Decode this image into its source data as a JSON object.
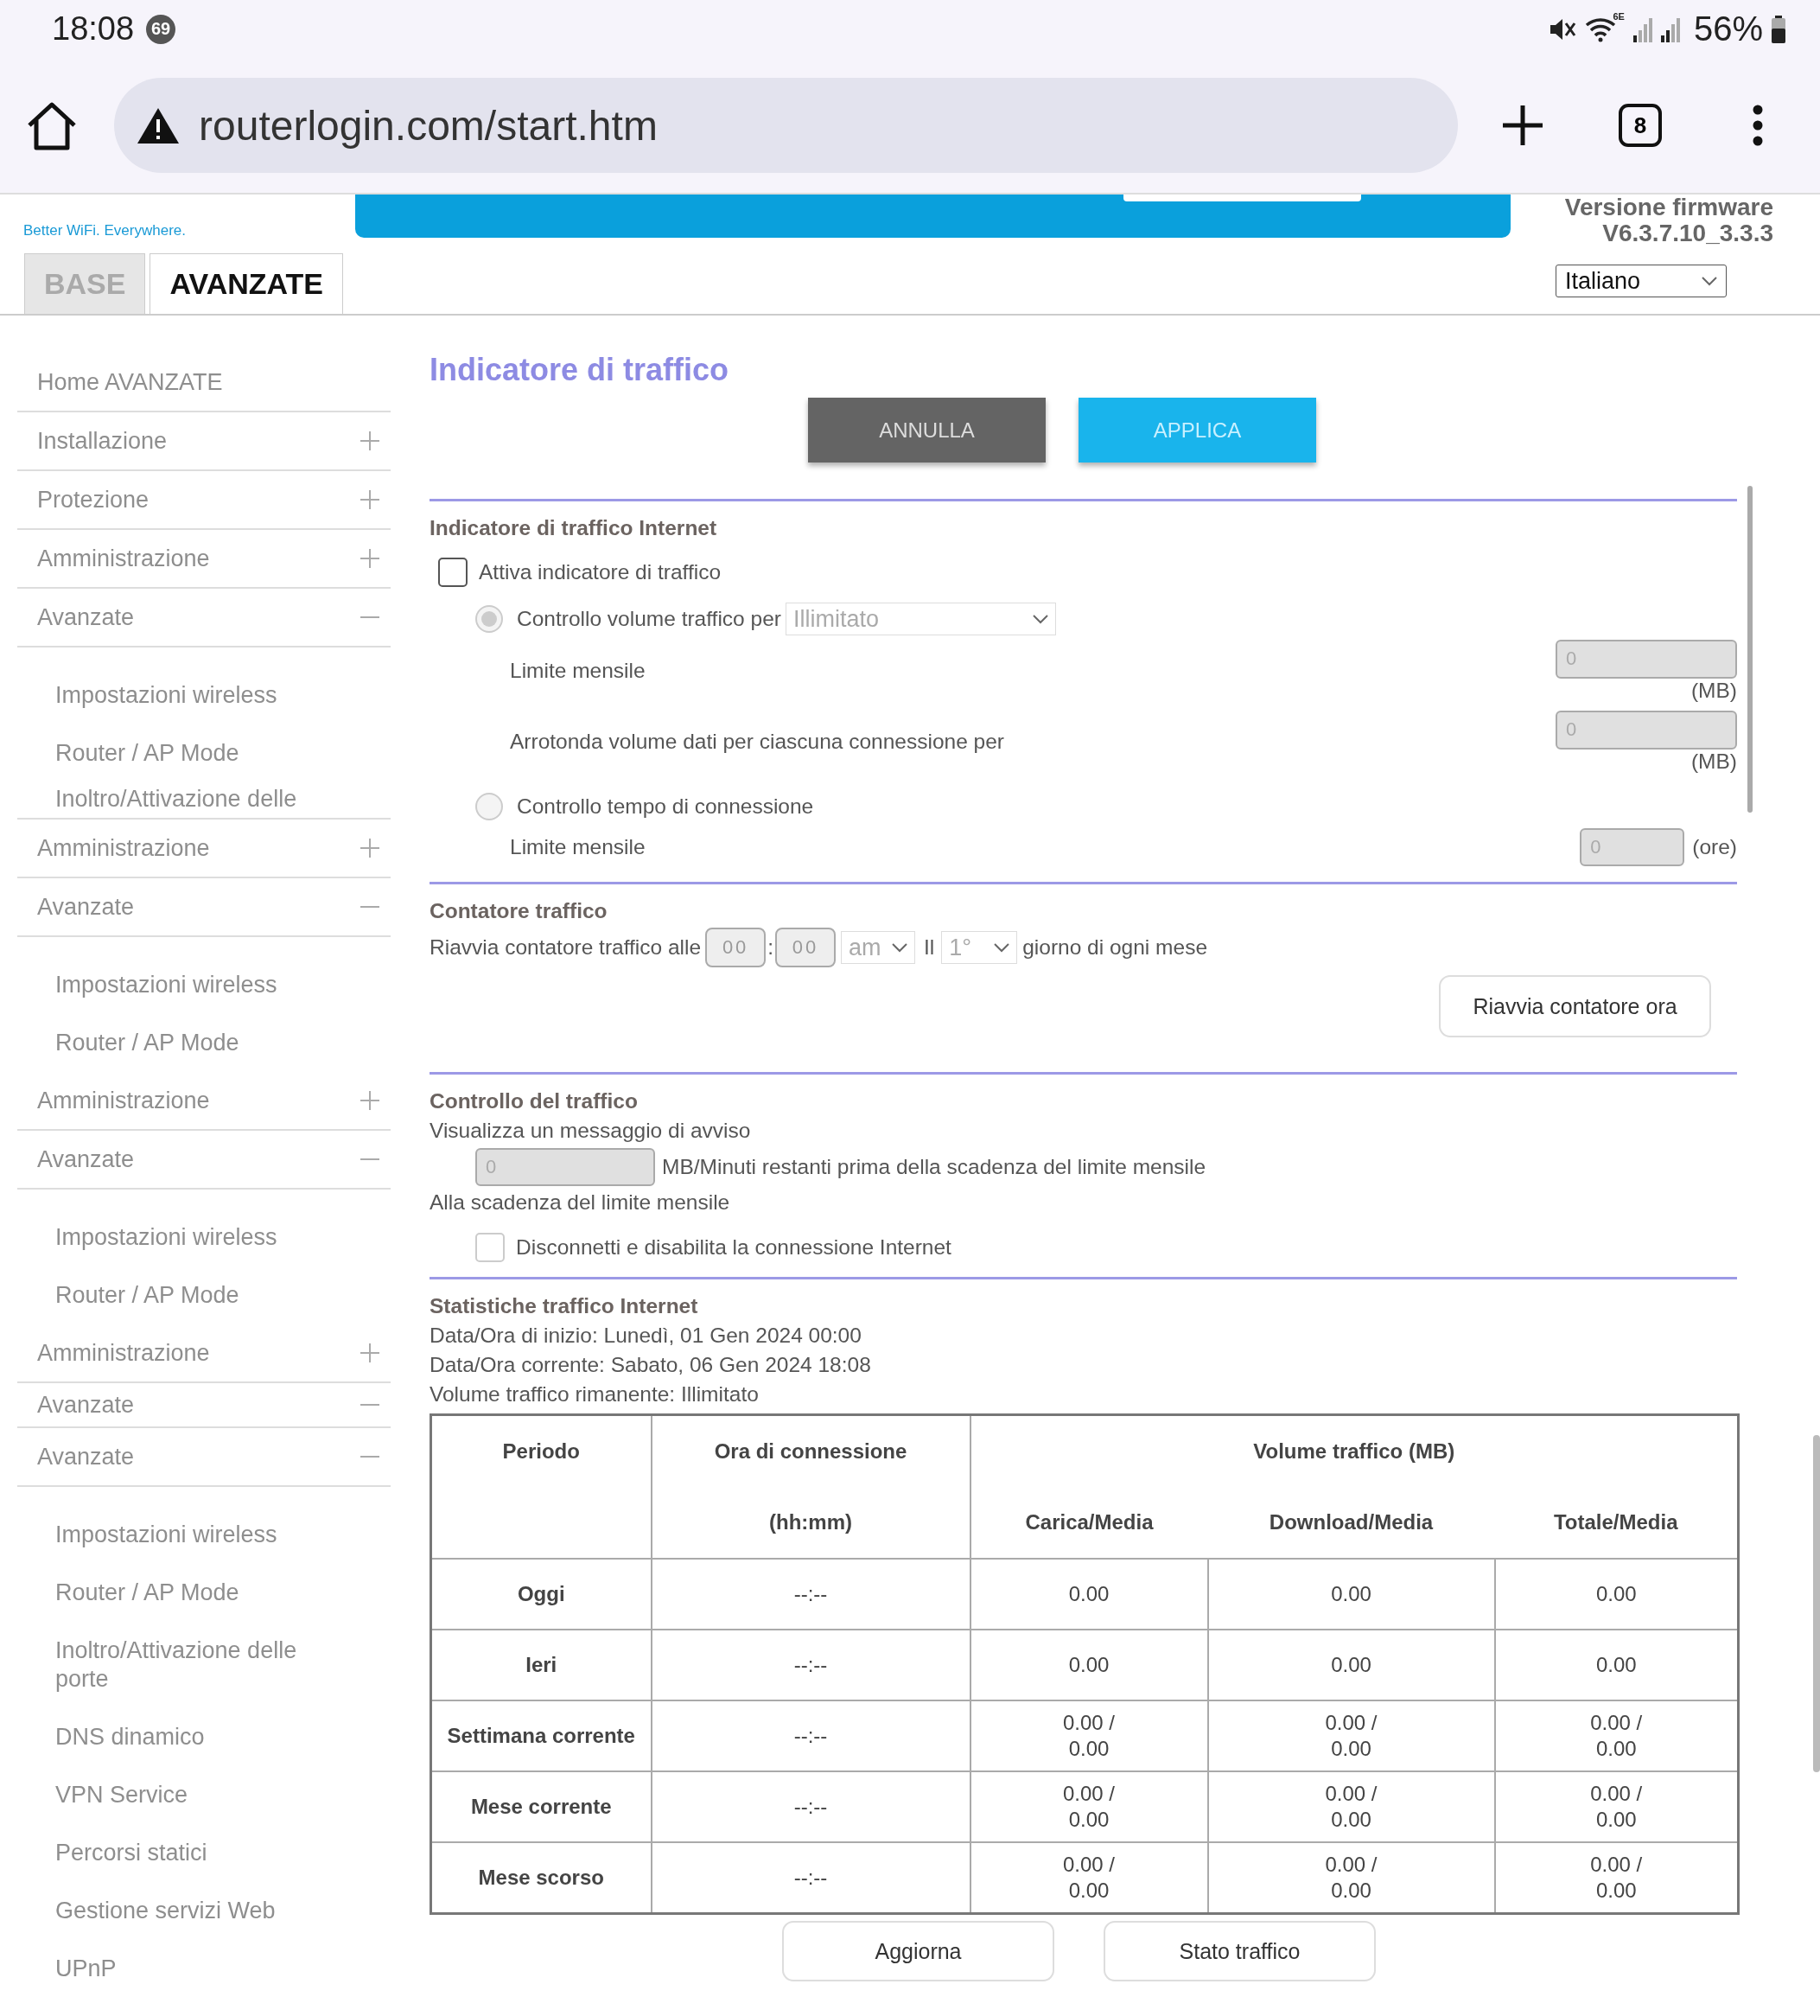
{
  "status_bar": {
    "time": "18:08",
    "notification_count": "69",
    "wifi_label": "6E",
    "battery": "56%"
  },
  "browser": {
    "url": "routerlogin.com/start.htm",
    "tab_count": "8"
  },
  "header": {
    "tagline": "Better WiFi. Everywhere.",
    "firmware_label": "Versione firmware",
    "firmware_version": "V6.3.7.10_3.3.3",
    "tabs": [
      {
        "label": "BASE",
        "selected": false
      },
      {
        "label": "AVANZATE",
        "selected": true
      }
    ],
    "language": "Italiano"
  },
  "sidebar": {
    "items": [
      {
        "label": "Home AVANZATE",
        "kind": "home"
      },
      {
        "label": "Installazione",
        "kind": "section",
        "expanded": false
      },
      {
        "label": "Protezione",
        "kind": "section",
        "expanded": false
      },
      {
        "label": "Amministrazione",
        "kind": "section",
        "expanded": false
      },
      {
        "label": "Avanzate",
        "kind": "section",
        "expanded": true,
        "children": [
          {
            "label": "Impostazioni wireless",
            "kind": "item"
          },
          {
            "label": "Router / AP Mode",
            "kind": "item"
          },
          {
            "label": "Inoltro/Attivazione delle",
            "kind": "cut"
          }
        ]
      },
      {
        "label": "Amministrazione",
        "kind": "section",
        "expanded": false
      },
      {
        "label": "Avanzate",
        "kind": "section",
        "expanded": true,
        "children": [
          {
            "label": "Impostazioni wireless",
            "kind": "item"
          },
          {
            "label": "Router / AP Mode",
            "kind": "item"
          }
        ]
      },
      {
        "label": "Amministrazione",
        "kind": "section",
        "expanded": false
      },
      {
        "label": "Avanzate",
        "kind": "section",
        "expanded": true,
        "children": [
          {
            "label": "Impostazioni wireless",
            "kind": "item"
          },
          {
            "label": "Router / AP Mode",
            "kind": "item"
          }
        ]
      },
      {
        "label": "Amministrazione",
        "kind": "section",
        "expanded": false
      },
      {
        "label": "Avanzate",
        "kind": "short",
        "expanded": true
      },
      {
        "label": "Avanzate",
        "kind": "section",
        "expanded": true,
        "children": [
          {
            "label": "Impostazioni wireless",
            "kind": "item"
          },
          {
            "label": "Router / AP Mode",
            "kind": "item"
          },
          {
            "label": "Inoltro/Attivazione delle porte",
            "kind": "item"
          },
          {
            "label": "DNS dinamico",
            "kind": "item"
          },
          {
            "label": "VPN Service",
            "kind": "item"
          },
          {
            "label": "Percorsi statici",
            "kind": "item"
          },
          {
            "label": "Gestione servizi Web",
            "kind": "item"
          },
          {
            "label": "UPnP",
            "kind": "item"
          }
        ]
      }
    ]
  },
  "main": {
    "title": "Indicatore di traffico",
    "buttons": [
      {
        "label": "ANNULLA",
        "kind": "cancel"
      },
      {
        "label": "APPLICA",
        "kind": "apply"
      }
    ],
    "meter": {
      "heading": "Indicatore di traffico Internet",
      "enable": {
        "label": "Attiva indicatore di traffico",
        "checked": false
      },
      "modes": [
        {
          "label": "Controllo volume traffico per",
          "selected": true
        },
        {
          "label": "Controllo tempo di connessione",
          "selected": false
        }
      ],
      "volume_select": "Illimitato",
      "monthly_limit": {
        "label": "Limite mensile",
        "value": "0",
        "unit": "(MB)"
      },
      "round_up": {
        "label": "Arrotonda volume dati per ciascuna connessione per",
        "value": "0",
        "unit": "(MB)"
      },
      "time_limit": {
        "label": "Limite mensile",
        "value": "0",
        "unit": "(ore)"
      }
    },
    "counter": {
      "heading": "Contatore traffico",
      "prefix": "Riavvia contatore traffico alle",
      "hour": "00",
      "time_separator": ":",
      "minute": "00",
      "ampm": "am",
      "day_prefix": "Il",
      "day": "1°",
      "suffix": "giorno di ogni mese",
      "restart_button": "Riavvia contatore ora"
    },
    "control": {
      "heading": "Controllo del traffico",
      "warning_label": "Visualizza un messaggio di avviso",
      "warning_value": "0",
      "warning_suffix": "MB/Minuti restanti prima della scadenza del limite mensile",
      "expiry_label": "Alla scadenza del limite mensile",
      "disconnect": {
        "label": "Disconnetti e disabilita la connessione Internet",
        "checked": false
      }
    },
    "stats": {
      "heading": "Statistiche traffico Internet",
      "lines": [
        "Data/Ora di inizio: Lunedì, 01 Gen 2024 00:00",
        "Data/Ora corrente: Sabato, 06 Gen 2024 18:08",
        "Volume traffico rimanente: Illimitato"
      ],
      "table": {
        "col_period": "Periodo",
        "col_time": "Ora di connessione",
        "col_time_unit": "(hh:mm)",
        "col_volume": "Volume traffico (MB)",
        "sub_columns": [
          "Carica/Media",
          "Download/Media",
          "Totale/Media"
        ],
        "rows": [
          {
            "period": "Oggi",
            "time": "--:--",
            "values": [
              "0.00",
              "0.00",
              "0.00"
            ]
          },
          {
            "period": "Ieri",
            "time": "--:--",
            "values": [
              "0.00",
              "0.00",
              "0.00"
            ]
          },
          {
            "period": "Settimana corrente",
            "time": "--:--",
            "values": [
              "0.00 /\n0.00",
              "0.00 /\n0.00",
              "0.00 /\n0.00"
            ]
          },
          {
            "period": "Mese corrente",
            "time": "--:--",
            "values": [
              "0.00 /\n0.00",
              "0.00 /\n0.00",
              "0.00 /\n0.00"
            ]
          },
          {
            "period": "Mese scorso",
            "time": "--:--",
            "values": [
              "0.00 /\n0.00",
              "0.00 /\n0.00",
              "0.00 /\n0.00"
            ]
          }
        ]
      },
      "buttons": [
        "Aggiorna",
        "Stato traffico"
      ]
    }
  }
}
